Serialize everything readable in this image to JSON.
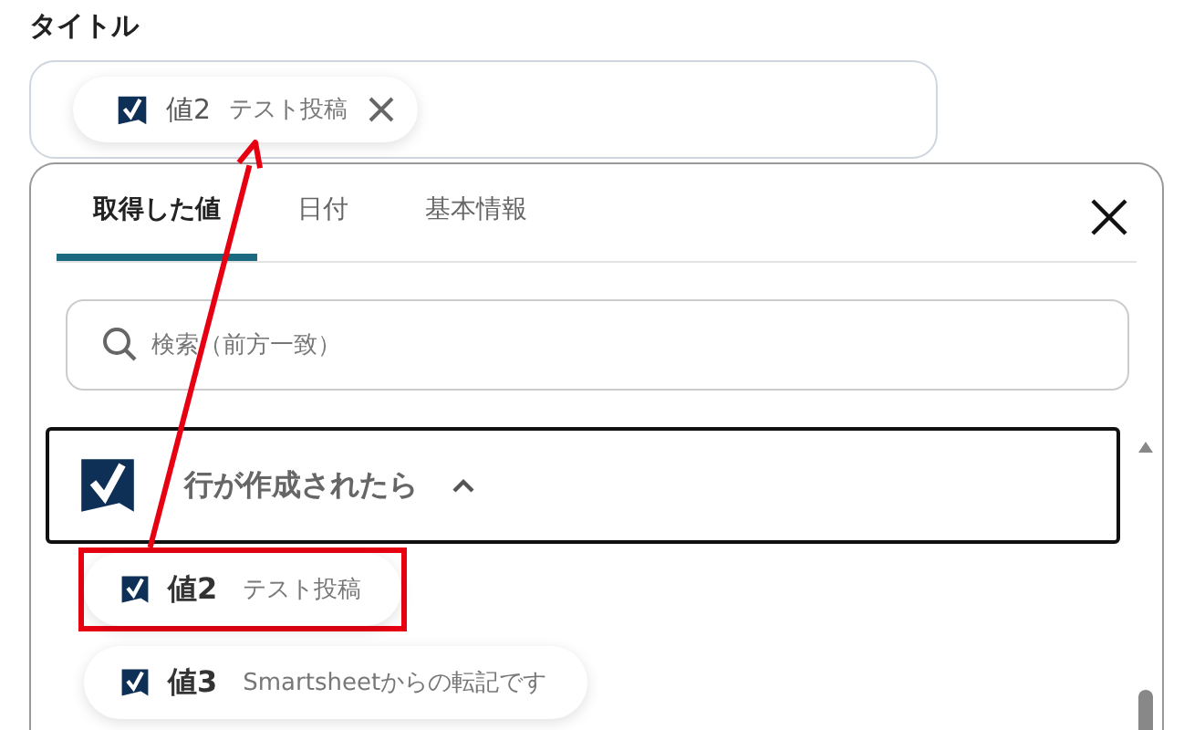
{
  "field": {
    "label": "タイトル",
    "chips": [
      {
        "name": "値2",
        "value": "テスト投稿"
      }
    ]
  },
  "tabs": [
    {
      "label": "取得した値",
      "selected": true
    },
    {
      "label": "日付",
      "selected": false
    },
    {
      "label": "基本情報",
      "selected": false
    }
  ],
  "search": {
    "placeholder": "検索（前方一致）"
  },
  "group": {
    "title": "行が作成されたら",
    "expanded": true,
    "items": [
      {
        "name": "値2",
        "value": "テスト投稿",
        "annotated": true
      },
      {
        "name": "値3",
        "value": "Smartsheetからの転記です",
        "annotated": false
      }
    ]
  }
}
